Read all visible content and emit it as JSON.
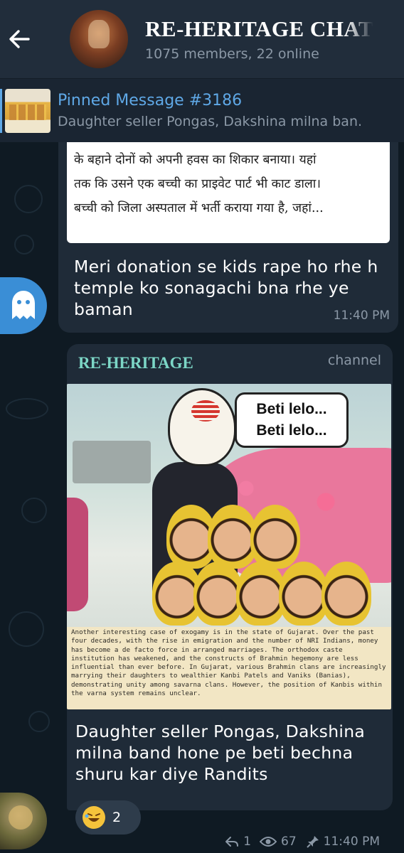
{
  "header": {
    "title": "RE-HERITAGE CHAT",
    "subtitle": "1075 members, 22 online"
  },
  "pinned": {
    "title": "Pinned Message #3186",
    "preview": "Daughter seller Pongas, Dakshina milna ban."
  },
  "message1": {
    "quoted_lines": [
      "के बहाने दोनों को अपनी हवस का शिकार बनाया। यहां",
      "तक कि उसने एक बच्ची का प्राइवेट पार्ट भी काट डाला।",
      "बच्ची को जिला अस्पताल में भर्ती कराया गया है, जहां..."
    ],
    "text": "Meri donation se kids rape ho rhe h temple ko sonagachi bna rhe ye baman",
    "time": "11:40 PM"
  },
  "message2": {
    "channel_name": "RE-HERITAGE",
    "channel_tag": "channel",
    "meme": {
      "speech_line1": "Beti lelo...",
      "speech_line2": "Beti lelo...",
      "caption": "Another interesting case of exogamy is in the state of Gujarat. Over the past four decades, with the rise in emigration and the number of NRI Indians, money has become a de facto force in arranged marriages. The orthodox caste institution has weakened, and the constructs of Brahmin hegemony are less influential than ever before. In Gujarat, various Brahmin clans are increasingly marrying their daughters to wealthier Kanbi Patels and Vaniks (Banias), demonstrating unity among savarna clans. However, the position of Kanbis within the varna system remains unclear."
    },
    "text": "Daughter seller Pongas, Dakshina milna band hone pe beti bechna shuru kar diye Randits",
    "reaction_count": "2",
    "replies": "1",
    "views": "67",
    "time": "11:40 PM"
  },
  "colors": {
    "header_bg": "#212d3b",
    "bubble_bg": "#1f2b38",
    "accent": "#5fa8e6",
    "channel": "#7cd6c6"
  }
}
